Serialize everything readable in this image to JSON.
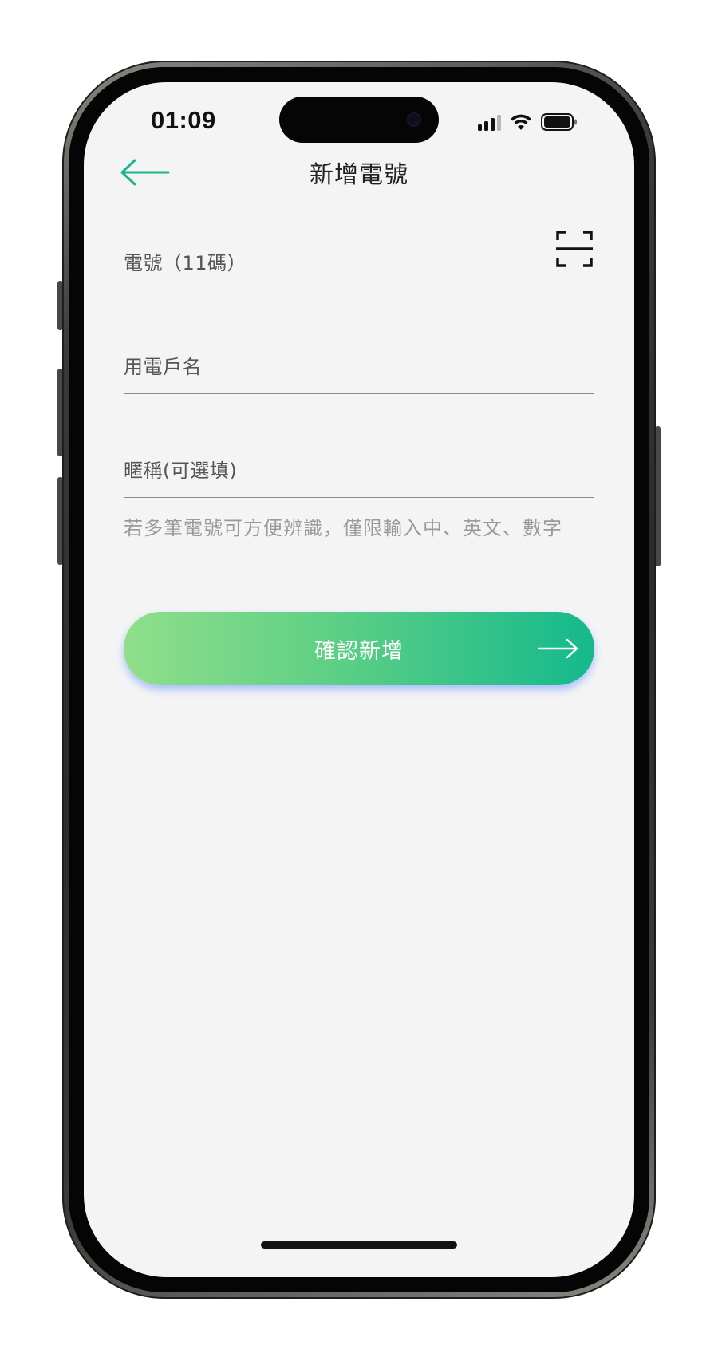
{
  "status_bar": {
    "time": "01:09",
    "signal_icon": "cellular-signal-icon",
    "wifi_icon": "wifi-icon",
    "battery_icon": "battery-icon"
  },
  "header": {
    "back_icon": "back-arrow-icon",
    "title": "新增電號"
  },
  "form": {
    "phone_label": "電號（11碼）",
    "scan_icon": "barcode-scan-icon",
    "name_label": "用電戶名",
    "nickname_label": "暱稱(可選填)",
    "nickname_hint": "若多筆電號可方便辨識，僅限輸入中、英文、數字"
  },
  "confirm_button": {
    "label": "確認新增",
    "arrow_icon": "arrow-right-icon"
  },
  "colors": {
    "accent": "#1cb48c",
    "button_gradient_start": "#90df8a",
    "button_gradient_end": "#14b98c",
    "background": "#f4f4f5"
  }
}
